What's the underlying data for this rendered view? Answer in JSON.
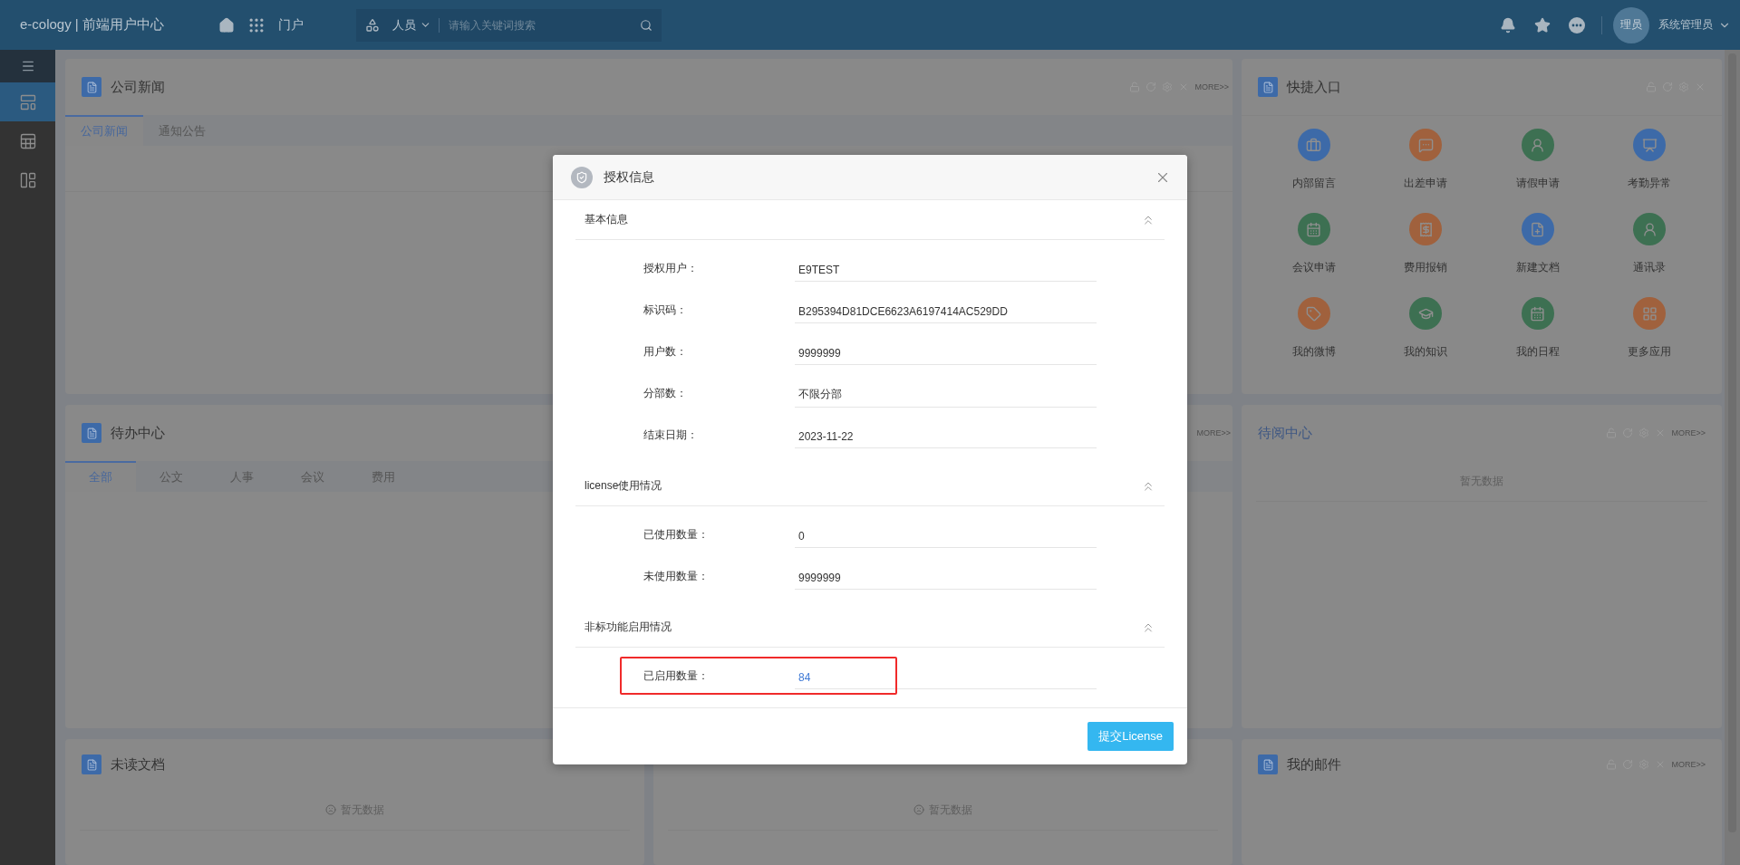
{
  "header": {
    "title": "e-cology | 前端用户中心",
    "portal": "门户",
    "search": {
      "scope": "人员",
      "placeholder": "请输入关键词搜索"
    },
    "avatar": "理员",
    "user": "系统管理员"
  },
  "sidebar": {
    "items": [
      {
        "kind": "layout",
        "selected": true
      },
      {
        "kind": "table",
        "selected": false
      },
      {
        "kind": "columns",
        "selected": false
      }
    ]
  },
  "panels": {
    "company_news": {
      "title": "公司新闻",
      "more": "MORE>>",
      "tabs": [
        {
          "label": "公司新闻",
          "selected": true
        },
        {
          "label": "通知公告",
          "selected": false
        }
      ]
    },
    "todo": {
      "title": "待办中心",
      "more": "MORE>>",
      "tabs": [
        {
          "label": "全部",
          "selected": true
        },
        {
          "label": "公文",
          "selected": false
        },
        {
          "label": "人事",
          "selected": false
        },
        {
          "label": "会议",
          "selected": false
        },
        {
          "label": "费用",
          "selected": false
        }
      ]
    },
    "quick": {
      "title": "快捷入口",
      "items": [
        {
          "label": "内部留言",
          "kind": "luggage",
          "color": "#3d6aa8"
        },
        {
          "label": "出差申请",
          "kind": "message",
          "color": "#a0613d"
        },
        {
          "label": "请假申请",
          "kind": "person",
          "color": "#3d7052"
        },
        {
          "label": "考勤异常",
          "kind": "chart",
          "color": "#3d6aa8"
        },
        {
          "label": "会议申请",
          "kind": "calendar",
          "color": "#3d7052"
        },
        {
          "label": "费用报销",
          "kind": "receipt",
          "color": "#a0613d"
        },
        {
          "label": "新建文档",
          "kind": "file",
          "color": "#3d6aa8"
        },
        {
          "label": "通讯录",
          "kind": "person",
          "color": "#3d7052"
        },
        {
          "label": "我的微博",
          "kind": "tag",
          "color": "#a0613d"
        },
        {
          "label": "我的知识",
          "kind": "cap",
          "color": "#3d7052"
        },
        {
          "label": "我的日程",
          "kind": "calendar",
          "color": "#3d7052"
        },
        {
          "label": "更多应用",
          "kind": "apps",
          "color": "#a0613d"
        }
      ]
    },
    "to_read": {
      "title": "待阅中心",
      "more": "MORE>>",
      "empty": "暂无数据"
    },
    "unread_docs": {
      "title": "未读文档",
      "empty": "暂无数据"
    },
    "downloads": {
      "empty": "暂无数据"
    },
    "mail": {
      "title": "我的邮件",
      "more": "MORE>>"
    }
  },
  "modal": {
    "title": "授权信息",
    "submit": "提交License",
    "sections": [
      {
        "title": "基本信息",
        "expanded": true,
        "rows": [
          {
            "label": "授权用户：",
            "value": "E9TEST",
            "kind": "text",
            "highlighted": false
          },
          {
            "label": "标识码：",
            "value": "B295394D81DCE6623A6197414AC529DD",
            "kind": "text",
            "highlighted": false
          },
          {
            "label": "用户数：",
            "value": "9999999",
            "kind": "text",
            "highlighted": false
          },
          {
            "label": "分部数：",
            "value": "不限分部",
            "kind": "text",
            "highlighted": false
          },
          {
            "label": "结束日期：",
            "value": "2023-11-22",
            "kind": "text",
            "highlighted": false
          }
        ]
      },
      {
        "title": "license使用情况",
        "expanded": true,
        "rows": [
          {
            "label": "已使用数量：",
            "value": "0",
            "kind": "text",
            "highlighted": false
          },
          {
            "label": "未使用数量：",
            "value": "9999999",
            "kind": "text",
            "highlighted": false
          }
        ]
      },
      {
        "title": "非标功能启用情况",
        "expanded": true,
        "rows": [
          {
            "label": "已启用数量：",
            "value": "84",
            "kind": "link",
            "highlighted": true
          }
        ]
      }
    ]
  }
}
